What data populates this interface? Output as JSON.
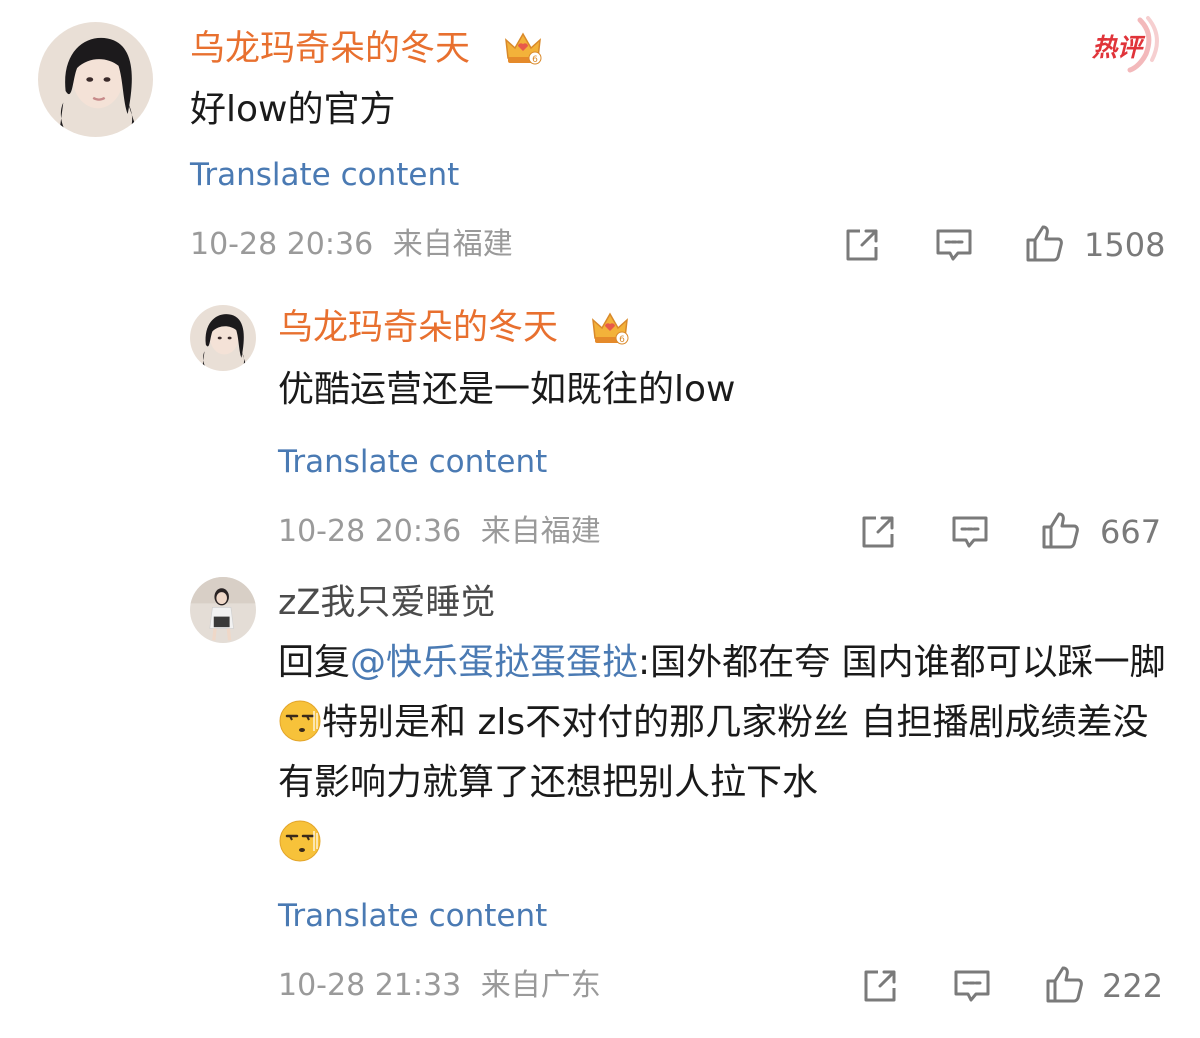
{
  "comments": [
    {
      "username": "乌龙玛奇朵的冬天",
      "vip_badge": "crown-icon",
      "text": "好low的官方",
      "translate": "Translate content",
      "timestamp": "10-28 20:36",
      "location": "来自福建",
      "likes": "1508"
    },
    {
      "username": "乌龙玛奇朵的冬天",
      "vip_badge": "crown-icon",
      "text": "优酷运营还是一如既往的low",
      "translate": "Translate content",
      "timestamp": "10-28 20:36",
      "location": "来自福建",
      "likes": "667"
    },
    {
      "username": "zZ我只爱睡觉",
      "reply_prefix": "回复",
      "mention": "@快乐蛋挞蛋蛋挞",
      "colon": ":",
      "text_part1": "国外都在夸 国内谁都可以踩一脚",
      "text_part2": "特别是和 zls不对付的那几家粉丝 自担播剧成绩差没有影响力就算了还想把别人拉下水",
      "emoji": "speechless-emoji",
      "translate": "Translate content",
      "timestamp": "10-28 21:33",
      "location": "来自广东",
      "likes": "222"
    }
  ],
  "hot_badge": "热评",
  "colors": {
    "username": "#e8702f",
    "link": "#4a7ab3",
    "meta": "#9a9a9a",
    "hot": "#e0343a"
  }
}
